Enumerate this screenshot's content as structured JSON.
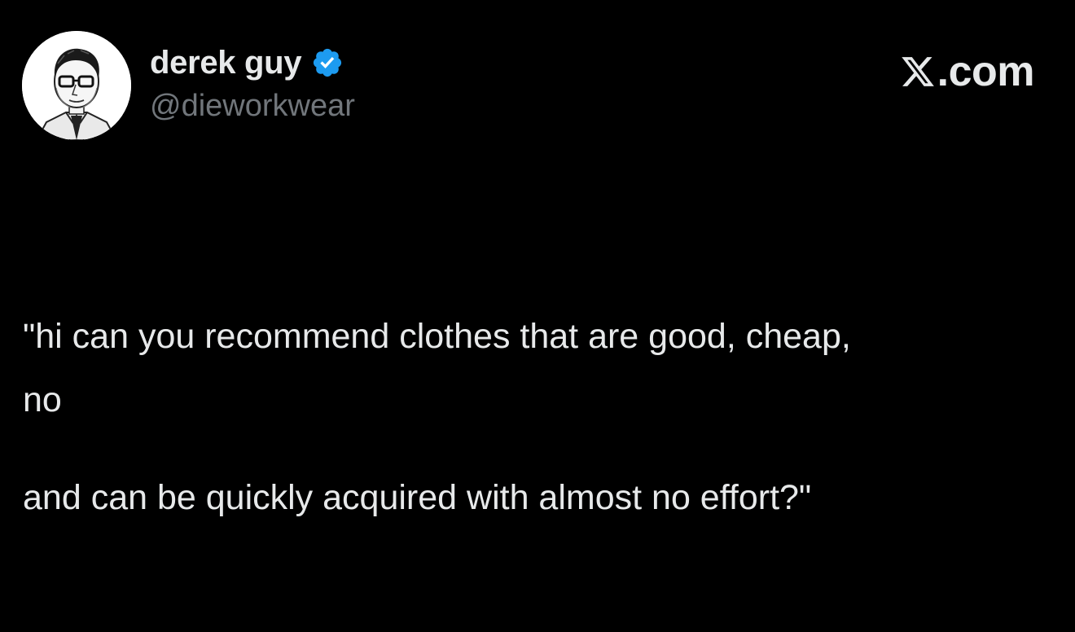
{
  "author": {
    "display_name": "derek guy",
    "handle": "@dieworkwear",
    "verified": true,
    "avatar_icon": "avatar-illustration"
  },
  "brand": {
    "logo_icon": "x-logo-icon",
    "text": ".com"
  },
  "tweet": {
    "line1": "\"hi can you recommend clothes that are good, cheap,",
    "line2": "and can be quickly acquired with almost no effort?\"",
    "reply": "no"
  },
  "colors": {
    "background": "#000000",
    "text_primary": "#e7e9ea",
    "text_secondary": "#71767b",
    "verified_blue": "#1d9bf0"
  }
}
